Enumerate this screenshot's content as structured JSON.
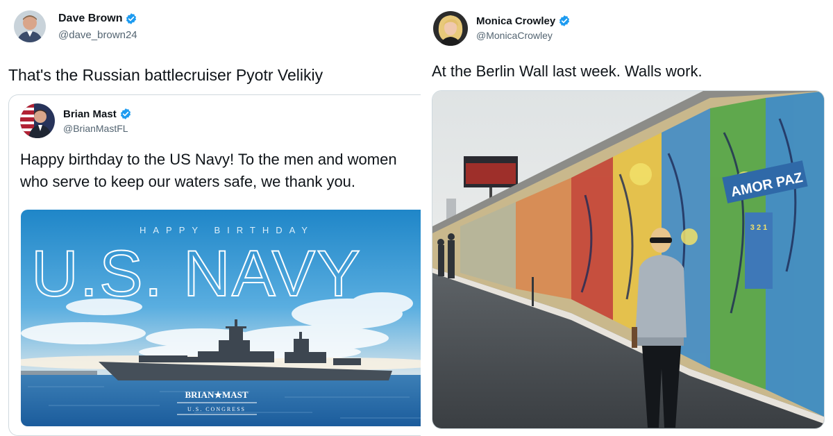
{
  "left_tweet": {
    "author_name": "Dave Brown",
    "author_handle": "@dave_brown24",
    "verified": true,
    "text": "That's the Russian battlecruiser Pyotr Velikiy",
    "quoted_tweet": {
      "author_name": "Brian Mast",
      "author_handle": "@BrianMastFL",
      "verified": true,
      "text_line1": "Happy birthday to the US Navy! To the men and women",
      "text_line2": "who serve to keep our waters safe, we thank you.",
      "media": {
        "overline": "HAPPY BIRTHDAY",
        "headline": "U.S. NAVY",
        "signature_name": "BRIAN★MAST",
        "signature_sub": "U.S. CONGRESS"
      }
    }
  },
  "right_tweet": {
    "author_name": "Monica Crowley",
    "author_handle": "@MonicaCrowley",
    "verified": true,
    "text": "At the Berlin Wall last week. Walls work.",
    "photo": {
      "wall_graffiti_1": "AMOR PAZ",
      "wall_graffiti_2": "3 2 1"
    }
  },
  "colors": {
    "verified_blue": "#1d9bf0",
    "text_primary": "#0f1419",
    "text_secondary": "#536471",
    "border": "#cfd9de"
  }
}
